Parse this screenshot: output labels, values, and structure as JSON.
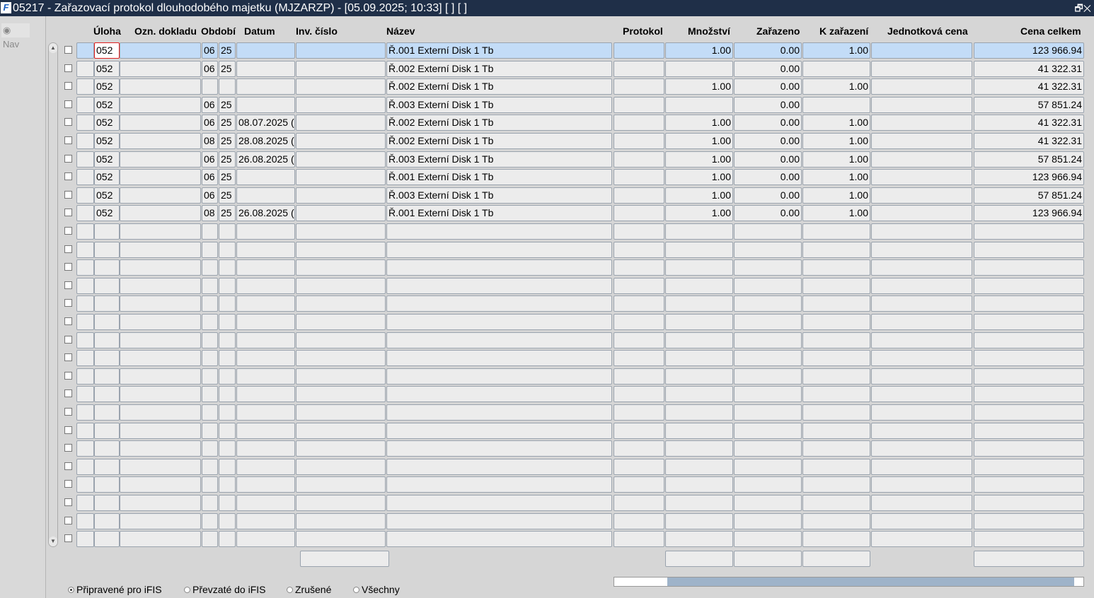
{
  "window": {
    "title": "05217 - Zařazovací protokol dlouhodobého majetku (MJZARZP) - [05.09.2025; 10:33]  [ ]  [ ]",
    "controls": "🗗✕"
  },
  "nav": {
    "label": "Nav"
  },
  "columns": {
    "uloha": "Úloha",
    "ozn": "Ozn. dokladu",
    "obdobi": "Období",
    "datum": "Datum",
    "inv": "Inv. číslo",
    "nazev": "Název",
    "protokol": "Protokol",
    "mnozstvi": "Množství",
    "zarazeno": "Zařazeno",
    "kzar": "K zařazení",
    "jedn": "Jednotková cena",
    "cena": "Cena celkem"
  },
  "rows": [
    {
      "uloha": "052",
      "m": "06",
      "y": "25",
      "datum": "",
      "nazev": "Ř.001 Externí Disk 1 Tb",
      "mnozstvi": "1.00",
      "zarazeno": "0.00",
      "kzar": "1.00",
      "cena": "123 966.94"
    },
    {
      "uloha": "052",
      "m": "06",
      "y": "25",
      "datum": "",
      "nazev": "Ř.002 Externí Disk 1 Tb",
      "mnozstvi": "",
      "zarazeno": "0.00",
      "kzar": "",
      "cena": "41 322.31"
    },
    {
      "uloha": "052",
      "m": "",
      "y": "",
      "datum": "",
      "nazev": "Ř.002 Externí Disk 1 Tb",
      "mnozstvi": "1.00",
      "zarazeno": "0.00",
      "kzar": "1.00",
      "cena": "41 322.31"
    },
    {
      "uloha": "052",
      "m": "06",
      "y": "25",
      "datum": "",
      "nazev": "Ř.003 Externí Disk 1 Tb",
      "mnozstvi": "",
      "zarazeno": "0.00",
      "kzar": "",
      "cena": "57 851.24"
    },
    {
      "uloha": "052",
      "m": "06",
      "y": "25",
      "datum": "08.07.2025 (",
      "nazev": "Ř.002 Externí Disk 1 Tb",
      "mnozstvi": "1.00",
      "zarazeno": "0.00",
      "kzar": "1.00",
      "cena": "41 322.31"
    },
    {
      "uloha": "052",
      "m": "08",
      "y": "25",
      "datum": "28.08.2025 (",
      "nazev": "Ř.002 Externí Disk 1 Tb",
      "mnozstvi": "1.00",
      "zarazeno": "0.00",
      "kzar": "1.00",
      "cena": "41 322.31"
    },
    {
      "uloha": "052",
      "m": "06",
      "y": "25",
      "datum": "26.08.2025 (",
      "nazev": "Ř.003 Externí Disk 1 Tb",
      "mnozstvi": "1.00",
      "zarazeno": "0.00",
      "kzar": "1.00",
      "cena": "57 851.24"
    },
    {
      "uloha": "052",
      "m": "06",
      "y": "25",
      "datum": "",
      "nazev": "Ř.001 Externí Disk 1 Tb",
      "mnozstvi": "1.00",
      "zarazeno": "0.00",
      "kzar": "1.00",
      "cena": "123 966.94"
    },
    {
      "uloha": "052",
      "m": "06",
      "y": "25",
      "datum": "",
      "nazev": "Ř.003 Externí Disk 1 Tb",
      "mnozstvi": "1.00",
      "zarazeno": "0.00",
      "kzar": "1.00",
      "cena": "57 851.24"
    },
    {
      "uloha": "052",
      "m": "08",
      "y": "25",
      "datum": "26.08.2025 (",
      "nazev": "Ř.001 Externí Disk 1 Tb",
      "mnozstvi": "1.00",
      "zarazeno": "0.00",
      "kzar": "1.00",
      "cena": "123 966.94"
    }
  ],
  "filters": [
    {
      "label": "Připravené pro iFIS",
      "selected": true
    },
    {
      "label": "Převzaté do iFIS",
      "selected": false
    },
    {
      "label": "Zrušené",
      "selected": false
    },
    {
      "label": "Všechny",
      "selected": false
    }
  ]
}
